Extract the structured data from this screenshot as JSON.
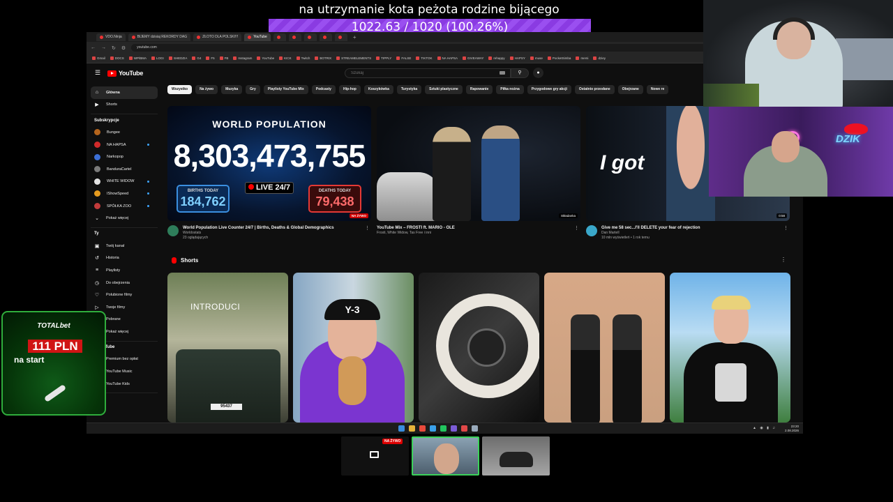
{
  "banner": {
    "title": "na utrzymanie kota peżota rodzine bijącego",
    "goal": "1022.63 / 1020 (100.26%)",
    "goal_progress": 1.0026,
    "goal_color": "#8a3be2"
  },
  "browser": {
    "tabs": [
      {
        "label": "VDO.Ninja",
        "active": false
      },
      {
        "label": "BIJEMY dzisiaj REKORDY DAG",
        "active": false
      },
      {
        "label": "ZŁOTO DLA POLSKI!!!",
        "active": false
      },
      {
        "label": "YouTube",
        "active": true
      },
      {
        "label": "",
        "active": false
      },
      {
        "label": "",
        "active": false
      },
      {
        "label": "",
        "active": false
      },
      {
        "label": "",
        "active": false
      },
      {
        "label": "",
        "active": false
      }
    ],
    "new_tab": "+",
    "url": "youtube.com",
    "bookmarks": [
      "Gmail",
      "DOCS",
      "WP/BMA",
      "LOGI",
      "SHEDZIA",
      "G4",
      "F5",
      "FB",
      "Instagram",
      "YouTube",
      "KICK",
      "Twitch",
      "BOTRIX",
      "STREAMELEMENTS",
      "TIPPLY",
      "FALSE",
      "TIKTOK",
      "NA HAPSA",
      "GIVEAWAY",
      "rehappy",
      "HAPSY",
      "muse",
      "PocketSimba",
      "memi",
      "dziey"
    ]
  },
  "youtube": {
    "logo": "YouTube",
    "search_placeholder": "Szukaj",
    "sidebar_main": [
      {
        "label": "Główna",
        "icon": "home-icon",
        "active": true
      },
      {
        "label": "Shorts",
        "icon": "shorts-icon",
        "active": false
      }
    ],
    "subscriptions_title": "Subskrypcje",
    "subscriptions": [
      {
        "label": "Bungee",
        "color": "#b5651d",
        "badge": false
      },
      {
        "label": "NA HAPSA",
        "color": "#d12a2a",
        "badge": true
      },
      {
        "label": "Narkopop",
        "color": "#3c6fd6",
        "badge": false
      },
      {
        "label": "BanduraCartel",
        "color": "#7b7b7b",
        "badge": false
      },
      {
        "label": "WHITE WIDOW",
        "color": "#e3e3e3",
        "badge": true
      },
      {
        "label": "IShowSpeed",
        "color": "#e69b1f",
        "badge": true
      },
      {
        "label": "SPÓŁKA ZOO",
        "color": "#c23b3b",
        "badge": true
      }
    ],
    "subscriptions_more": "Pokaż więcej",
    "you_title": "Ty",
    "you_items": [
      {
        "label": "Twój kanał",
        "icon": "channel-icon"
      },
      {
        "label": "Historia",
        "icon": "history-icon"
      },
      {
        "label": "Playlisty",
        "icon": "playlist-icon"
      },
      {
        "label": "Do obejrzenia",
        "icon": "clock-icon"
      },
      {
        "label": "Polubione filmy",
        "icon": "like-icon"
      },
      {
        "label": "Twoje filmy",
        "icon": "video-icon"
      },
      {
        "label": "Pobrane",
        "icon": "download-icon"
      },
      {
        "label": "Pokaż więcej",
        "icon": "chevron-down-icon"
      }
    ],
    "more_title": "z YouTube",
    "more_items": [
      {
        "label": "Premium bez opłat",
        "color": "#f00"
      },
      {
        "label": "YouTube Music",
        "color": "#f00"
      },
      {
        "label": "YouTube Kids",
        "color": "#f00"
      }
    ],
    "more_cutoff": "waj",
    "chips": [
      "Wszystko",
      "Na żywo",
      "Muzyka",
      "Gry",
      "Playlisty YouTube Mix",
      "Podcasty",
      "Hip-hop",
      "Koszykówka",
      "Turystyka",
      "Sztuki plastyczne",
      "Rapowanie",
      "Piłka nożna",
      "Przygodowe gry akcji",
      "Ostatnio przesłane",
      "Obejrzane",
      "Nowe re"
    ],
    "videos": [
      {
        "title": "World Population Live Counter 24/7 | Births, Deaths & Global Demographics",
        "channel": "Worldostats",
        "stats": "23 oglądających",
        "thumb_heading": "WORLD POPULATION",
        "thumb_count": "8,303,473,755",
        "births_label": "BIRTHS TODAY",
        "births_value": "184,762",
        "live_label": "LIVE 24/7",
        "deaths_label": "DEATHS TODAY",
        "deaths_value": "79,438",
        "badge": "NA ŻYWO",
        "avatar_color": "#2e7d5a"
      },
      {
        "title": "YouTube Mix – FROSTI ft. MARIO - OLE",
        "channel": "Frosti, White Widow, Tas Free i inni",
        "stats": "",
        "badge": "Składanka"
      },
      {
        "title": "Give me 58 sec...I'll DELETE your fear of rejection",
        "channel": "Dan Martell",
        "stats": "10 mln wyświetleń • 1 rok temu",
        "thumb_text": "I got",
        "duration": "0:58",
        "avatar_color": "#3aa7c9"
      }
    ],
    "shorts_title": "Shorts",
    "shorts": [
      {
        "overlay": "INTRODUCI",
        "plate": "95437"
      },
      {
        "overlay": "Y-3"
      },
      {
        "overlay": ""
      },
      {
        "overlay": ""
      },
      {
        "overlay": ""
      }
    ]
  },
  "taskbar": {
    "time": "23:20",
    "date": "2.08.2026",
    "icon_colors": [
      "#3a8dde",
      "#e5b23a",
      "#e84a3b",
      "#3aa0e8",
      "#22c55e",
      "#7b5cd6",
      "#e04848",
      "#9ab"
    ]
  },
  "webcam": {
    "neon_sign": "DZIK"
  },
  "promo": {
    "brand": "TOTALbet",
    "amount": "111 PLN",
    "subtitle": "na start"
  },
  "scenes": {
    "live_badge": "NA ŻYWO"
  }
}
